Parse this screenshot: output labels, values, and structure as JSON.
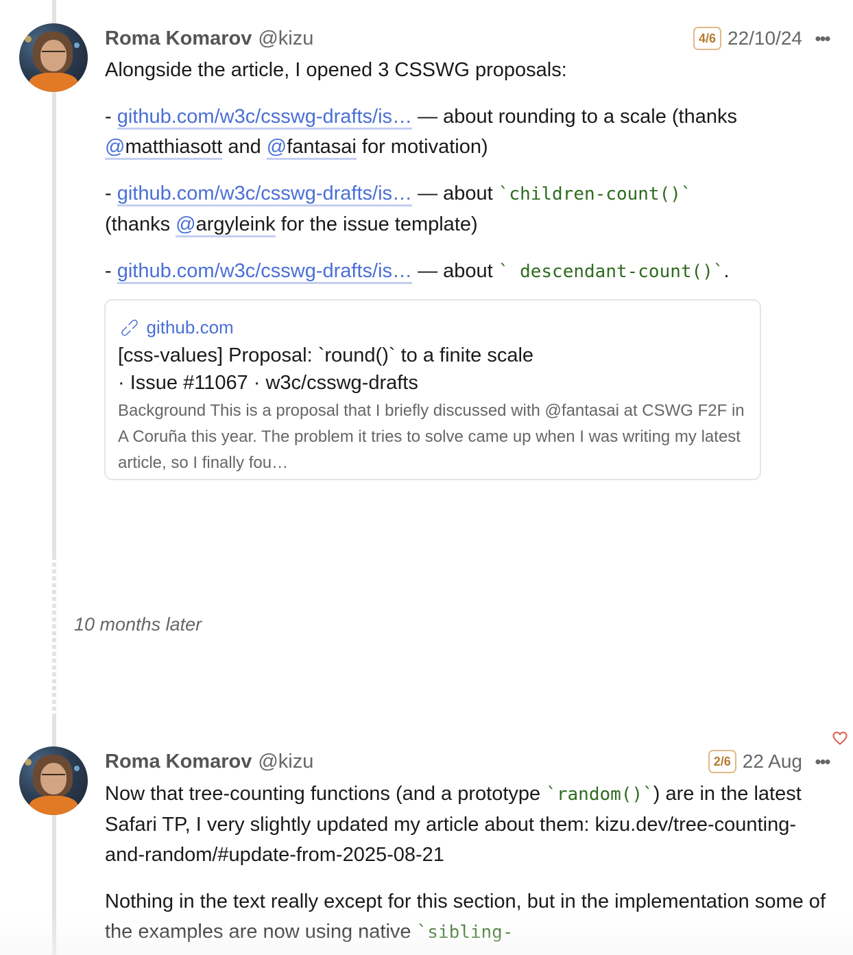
{
  "posts": [
    {
      "author_name": "Roma Komarov",
      "author_handle": "@kizu",
      "position_badge": "4/6",
      "date": "22/10/24",
      "intro": "Alongside the article, I opened 3 CSSWG proposals:",
      "items": [
        {
          "prefix": "- ",
          "link": "github.com/w3c/csswg-drafts/is…",
          "text_a": " — about rounding to a scale (thanks ",
          "mention_1": "matthiasott",
          "text_b": " and ",
          "mention_2": "fantasai",
          "text_c": " for motivation)"
        },
        {
          "prefix": "- ",
          "link": "github.com/w3c/csswg-drafts/is…",
          "text_a": " — about ",
          "code": "`children-count()`",
          "text_b": "(thanks ",
          "mention_1": "argyleink",
          "text_c": " for the issue template)"
        },
        {
          "prefix": "- ",
          "link": "github.com/w3c/csswg-drafts/is…",
          "text_a": " — about ",
          "code": "` descendant-count()`",
          "text_b": "."
        }
      ],
      "link_card": {
        "domain": "github.com",
        "title": "[css-values] Proposal: `round()` to a finite scale · Issue #11067 · w3c/csswg-drafts",
        "description": "Background This is a proposal that I briefly discussed with @fantasai at CSWG F2F in A Coruña this year. The problem it tries to solve came up when I was writing my latest article, so I finally fou…"
      }
    },
    {
      "author_name": "Roma Komarov",
      "author_handle": "@kizu",
      "position_badge": "2/6",
      "date": "22 Aug",
      "para1_a": "Now that tree-counting functions (and a prototype ",
      "para1_code": "`random()`",
      "para1_b": ") are in the latest Safari TP, I very slightly updated my article about them: kizu.dev/tree-counting-and-random/#update-from-2025-08-21",
      "para2_a": "Nothing in the text really except for this section, but in the implementation some of the examples are now using native ",
      "para2_code": "`sibling-"
    }
  ],
  "time_gap": "10 months later",
  "icons": {
    "more": "more-horizontal-icon",
    "link": "link-icon",
    "heart": "heart-icon"
  },
  "colors": {
    "link": "#4a6fd6",
    "code": "#2e6b1f",
    "badge": "#b77a2e",
    "heart": "#e0584c"
  }
}
